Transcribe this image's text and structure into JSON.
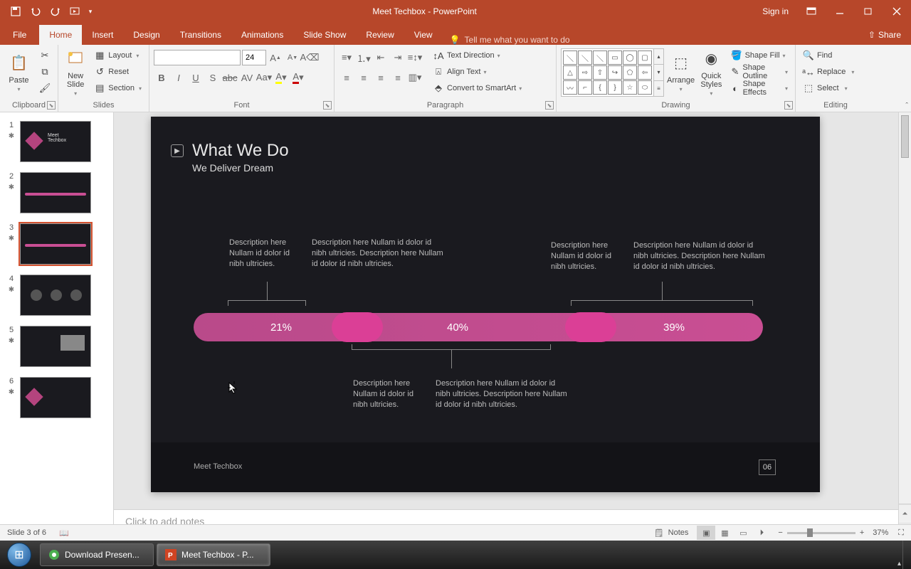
{
  "titlebar": {
    "title": "Meet Techbox - PowerPoint",
    "signin": "Sign in"
  },
  "tabs": {
    "file": "File",
    "items": [
      "Home",
      "Insert",
      "Design",
      "Transitions",
      "Animations",
      "Slide Show",
      "Review",
      "View"
    ],
    "active": "Home",
    "tellme": "Tell me what you want to do",
    "share": "Share"
  },
  "ribbon": {
    "clipboard": {
      "label": "Clipboard",
      "paste": "Paste",
      "cut": "Cut",
      "copy": "Copy",
      "painter": ""
    },
    "slides": {
      "label": "Slides",
      "new_slide": "New\nSlide",
      "layout": "Layout",
      "reset": "Reset",
      "section": "Section"
    },
    "font": {
      "label": "Font",
      "name": "",
      "size": "24"
    },
    "paragraph": {
      "label": "Paragraph",
      "textdir": "Text Direction",
      "align": "Align Text",
      "smartart": "Convert to SmartArt"
    },
    "drawing": {
      "label": "Drawing",
      "arrange": "Arrange",
      "quick": "Quick\nStyles",
      "fill": "Shape Fill",
      "outline": "Shape Outline",
      "effects": "Shape Effects"
    },
    "editing": {
      "label": "Editing",
      "find": "Find",
      "replace": "Replace",
      "select": "Select"
    }
  },
  "thumbs": {
    "count": 6,
    "active": 3
  },
  "slide": {
    "title": "What We Do",
    "subtitle": "We Deliver Dream",
    "segments": [
      {
        "pct": "21%",
        "d1": "Description here Nullam id dolor id nibh ultricies.",
        "d2": "Description here Nullam id dolor id nibh ultricies. Description here Nullam id dolor id nibh ultricies."
      },
      {
        "pct": "40%",
        "d1": "Description here Nullam id dolor id nibh ultricies.",
        "d2": "Description here Nullam id dolor id nibh ultricies. Description here Nullam id dolor id nibh ultricies."
      },
      {
        "pct": "39%",
        "d1": "Description here Nullam id dolor id nibh ultricies.",
        "d2": "Description here Nullam id dolor id nibh ultricies. Description here Nullam id dolor id nibh ultricies."
      }
    ],
    "footer_text": "Meet Techbox",
    "page_no": "06"
  },
  "notes": {
    "placeholder": "Click to add notes"
  },
  "status": {
    "slide_info": "Slide 3 of 6",
    "notes": "Notes",
    "zoom": "37%"
  },
  "taskbar": {
    "items": [
      {
        "label": "Download Presen...",
        "color": "#4caf50"
      },
      {
        "label": "Meet Techbox - P...",
        "color": "#D04423"
      }
    ]
  }
}
